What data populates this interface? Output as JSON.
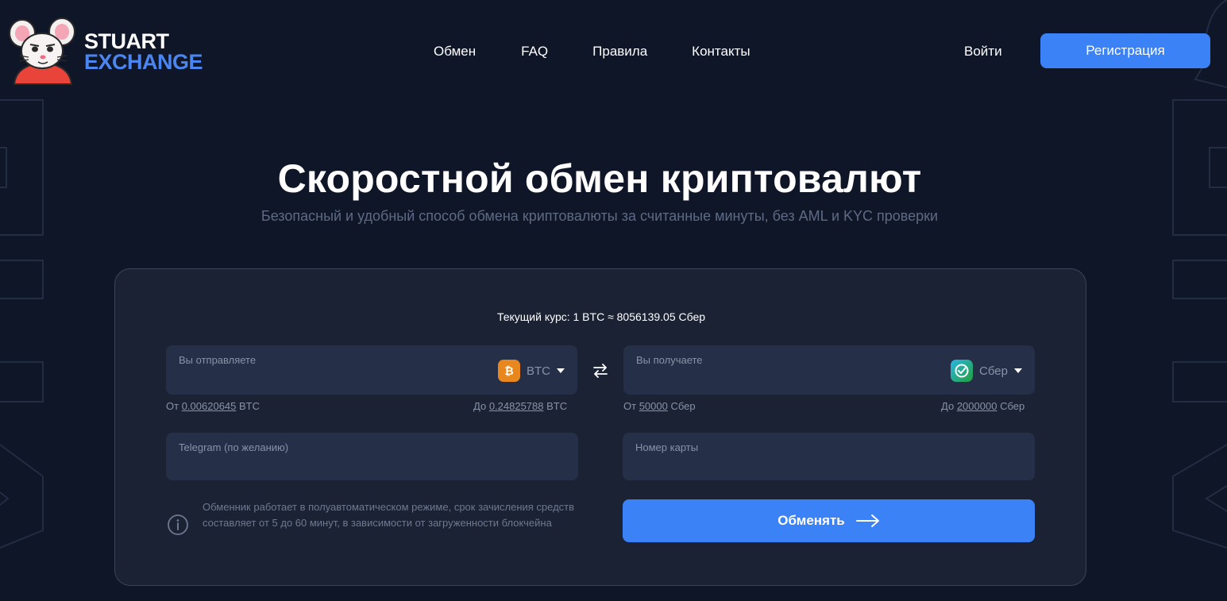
{
  "brand": {
    "line1": "STUART",
    "line2": "EXCHANGE"
  },
  "nav": {
    "items": [
      "Обмен",
      "FAQ",
      "Правила",
      "Контакты"
    ]
  },
  "auth": {
    "login": "Войти",
    "register": "Регистрация"
  },
  "hero": {
    "title": "Скоростной обмен криптовалют",
    "subtitle": "Безопасный и удобный способ обмена криптовалюты за считанные минуты, без AML и KYC проверки"
  },
  "exchange": {
    "rate": "Текущий курс: 1 BTC ≈ 8056139.05 Сбер",
    "send": {
      "label": "Вы отправляете",
      "currency": "BTC",
      "min_prefix": "От",
      "min_value": "0.00620645",
      "min_unit": "BTC",
      "max_prefix": "До",
      "max_value": "0.24825788",
      "max_unit": "BTC"
    },
    "receive": {
      "label": "Вы получаете",
      "currency": "Сбер",
      "min_prefix": "От",
      "min_value": "50000",
      "min_unit": "Сбер",
      "max_prefix": "До",
      "max_value": "2000000",
      "max_unit": "Сбер"
    },
    "telegram_label": "Telegram (по желанию)",
    "card_label": "Номер карты",
    "info": "Обменник работает в полуавтоматическом режиме, срок зачисления средств составляет от 5 до 60 минут, в зависимости от загруженности блокчейна",
    "submit": "Обменять"
  },
  "colors": {
    "background": "#0f1628",
    "card": "#1a2234",
    "field": "#252f47",
    "accent": "#3b82f6",
    "brand_blue": "#4b86f0",
    "btc": "#e8871e"
  },
  "icons": [
    "bitcoin-icon",
    "sber-icon",
    "swap-icon",
    "info-icon",
    "arrow-right-icon",
    "mouse-mascot-logo"
  ]
}
